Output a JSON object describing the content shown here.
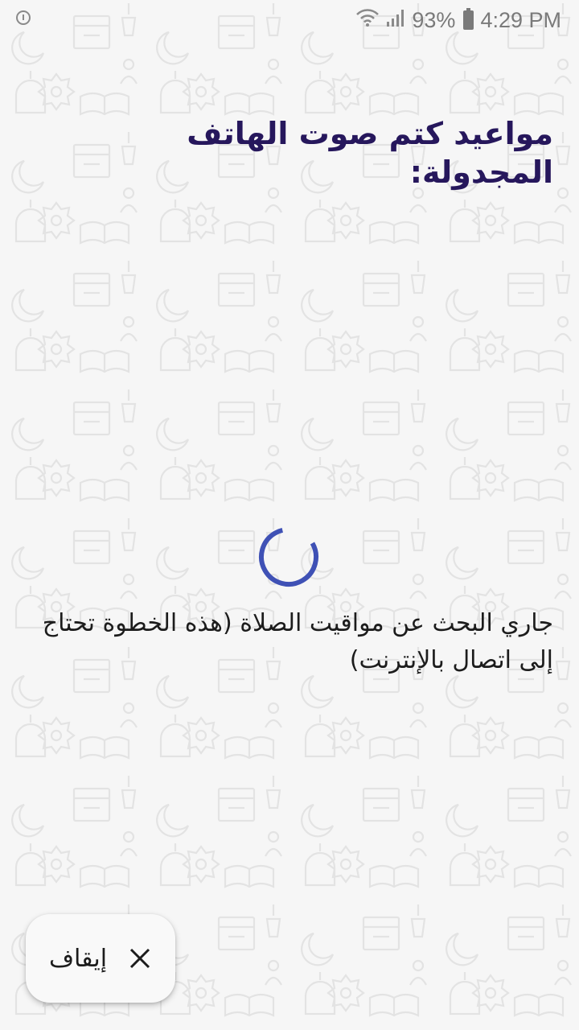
{
  "status_bar": {
    "battery_percent": "93%",
    "time": "4:29 PM",
    "icons": [
      "alert-icon",
      "wifi-icon",
      "signal-icon",
      "battery-icon"
    ]
  },
  "main": {
    "title": "مواعيد كتم صوت الهاتف المجدولة:",
    "loading_message": "جاري البحث عن مواقيت الصلاة (هذه الخطوة تحتاج إلى اتصال بالإنترنت)",
    "spinner_color": "#3f51b5"
  },
  "actions": {
    "stop_label": "إيقاف",
    "stop_icon": "close-icon"
  },
  "colors": {
    "title": "#26175c",
    "background": "#f6f6f6"
  }
}
